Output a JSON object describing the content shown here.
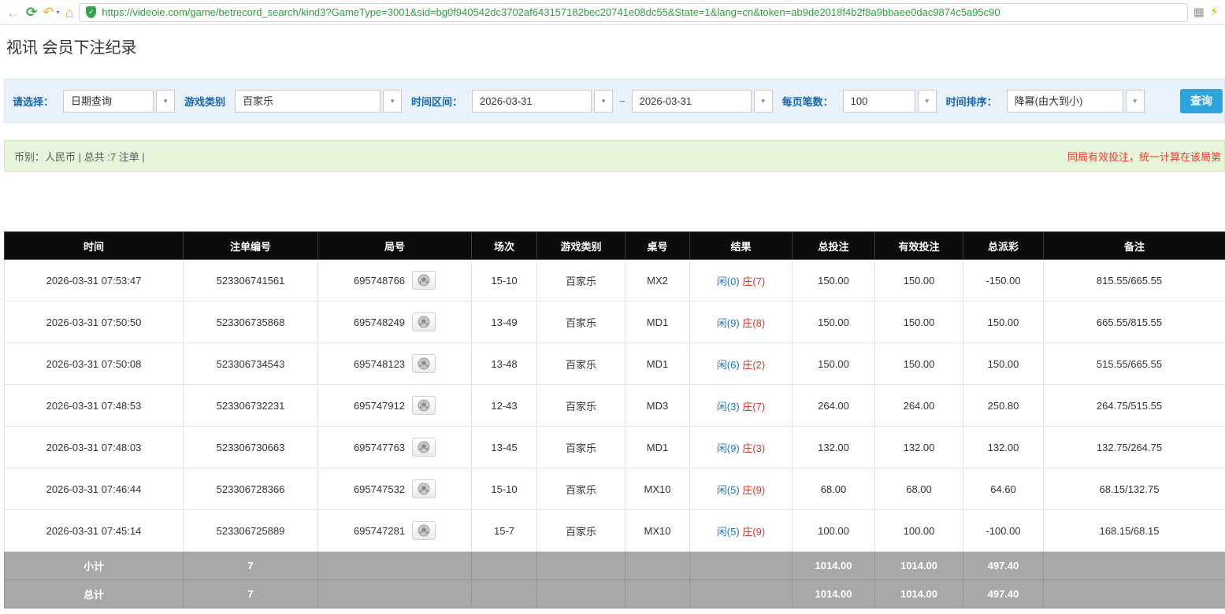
{
  "icons": {
    "back": "←",
    "refresh": "⟳",
    "undo": "↶",
    "caret_small": "▾",
    "home": "⌂",
    "shield_check": "✓",
    "grid": "▦",
    "lightning": "⚡",
    "caret_down": "▼"
  },
  "browser": {
    "url": "https://videoie.com/game/betrecord_search/kind3?GameType=3001&sid=bg0f940542dc3702af643157182bec20741e08dc55&State=1&lang=cn&token=ab9de2018f4b2f8a9bbaee0dac9874c5a95c90"
  },
  "page": {
    "title": "视讯 会员下注纪录"
  },
  "filters": {
    "select_label": "请选择：",
    "select_value": "日期查询",
    "game_type_label": "游戏类别",
    "game_type_value": "百家乐",
    "time_range_label": "时间区间：",
    "date_from": "2026-03-31",
    "tilde": "~",
    "date_to": "2026-03-31",
    "page_size_label": "每页笔数：",
    "page_size_value": "100",
    "sort_label": "时间排序：",
    "sort_value": "降幂(由大到小)",
    "search_button": "查询"
  },
  "summary": {
    "left": "币别：人民币 | 总共 :7 注单 |",
    "right": "同局有效投注，统一计算在该局第"
  },
  "table": {
    "headers": [
      "时间",
      "注单编号",
      "局号",
      "场次",
      "游戏类别",
      "桌号",
      "结果",
      "总投注",
      "有效投注",
      "总派彩",
      "备注"
    ],
    "rows": [
      {
        "time": "2026-03-31 07:53:47",
        "bet_id": "523306741561",
        "round_id": "695748766",
        "session": "15-10",
        "game": "百家乐",
        "table": "MX2",
        "player": "闲(0)",
        "banker": "庄(7)",
        "total_bet": "150.00",
        "valid_bet": "150.00",
        "payout": "-150.00",
        "note": "815.55/665.55"
      },
      {
        "time": "2026-03-31 07:50:50",
        "bet_id": "523306735868",
        "round_id": "695748249",
        "session": "13-49",
        "game": "百家乐",
        "table": "MD1",
        "player": "闲(9)",
        "banker": "庄(8)",
        "total_bet": "150.00",
        "valid_bet": "150.00",
        "payout": "150.00",
        "note": "665.55/815.55"
      },
      {
        "time": "2026-03-31 07:50:08",
        "bet_id": "523306734543",
        "round_id": "695748123",
        "session": "13-48",
        "game": "百家乐",
        "table": "MD1",
        "player": "闲(6)",
        "banker": "庄(2)",
        "total_bet": "150.00",
        "valid_bet": "150.00",
        "payout": "150.00",
        "note": "515.55/665.55"
      },
      {
        "time": "2026-03-31 07:48:53",
        "bet_id": "523306732231",
        "round_id": "695747912",
        "session": "12-43",
        "game": "百家乐",
        "table": "MD3",
        "player": "闲(3)",
        "banker": "庄(7)",
        "total_bet": "264.00",
        "valid_bet": "264.00",
        "payout": "250.80",
        "note": "264.75/515.55"
      },
      {
        "time": "2026-03-31 07:48:03",
        "bet_id": "523306730663",
        "round_id": "695747763",
        "session": "13-45",
        "game": "百家乐",
        "table": "MD1",
        "player": "闲(9)",
        "banker": "庄(3)",
        "total_bet": "132.00",
        "valid_bet": "132.00",
        "payout": "132.00",
        "note": "132.75/264.75"
      },
      {
        "time": "2026-03-31 07:46:44",
        "bet_id": "523306728366",
        "round_id": "695747532",
        "session": "15-10",
        "game": "百家乐",
        "table": "MX10",
        "player": "闲(5)",
        "banker": "庄(9)",
        "total_bet": "68.00",
        "valid_bet": "68.00",
        "payout": "64.60",
        "note": "68.15/132.75"
      },
      {
        "time": "2026-03-31 07:45:14",
        "bet_id": "523306725889",
        "round_id": "695747281",
        "session": "15-7",
        "game": "百家乐",
        "table": "MX10",
        "player": "闲(5)",
        "banker": "庄(9)",
        "total_bet": "100.00",
        "valid_bet": "100.00",
        "payout": "-100.00",
        "note": "168.15/68.15"
      }
    ],
    "subtotal": {
      "label": "小计",
      "count": "7",
      "total_bet": "1014.00",
      "valid_bet": "1014.00",
      "payout": "497.40"
    },
    "total": {
      "label": "总计",
      "count": "7",
      "total_bet": "1014.00",
      "valid_bet": "1014.00",
      "payout": "497.40"
    }
  }
}
